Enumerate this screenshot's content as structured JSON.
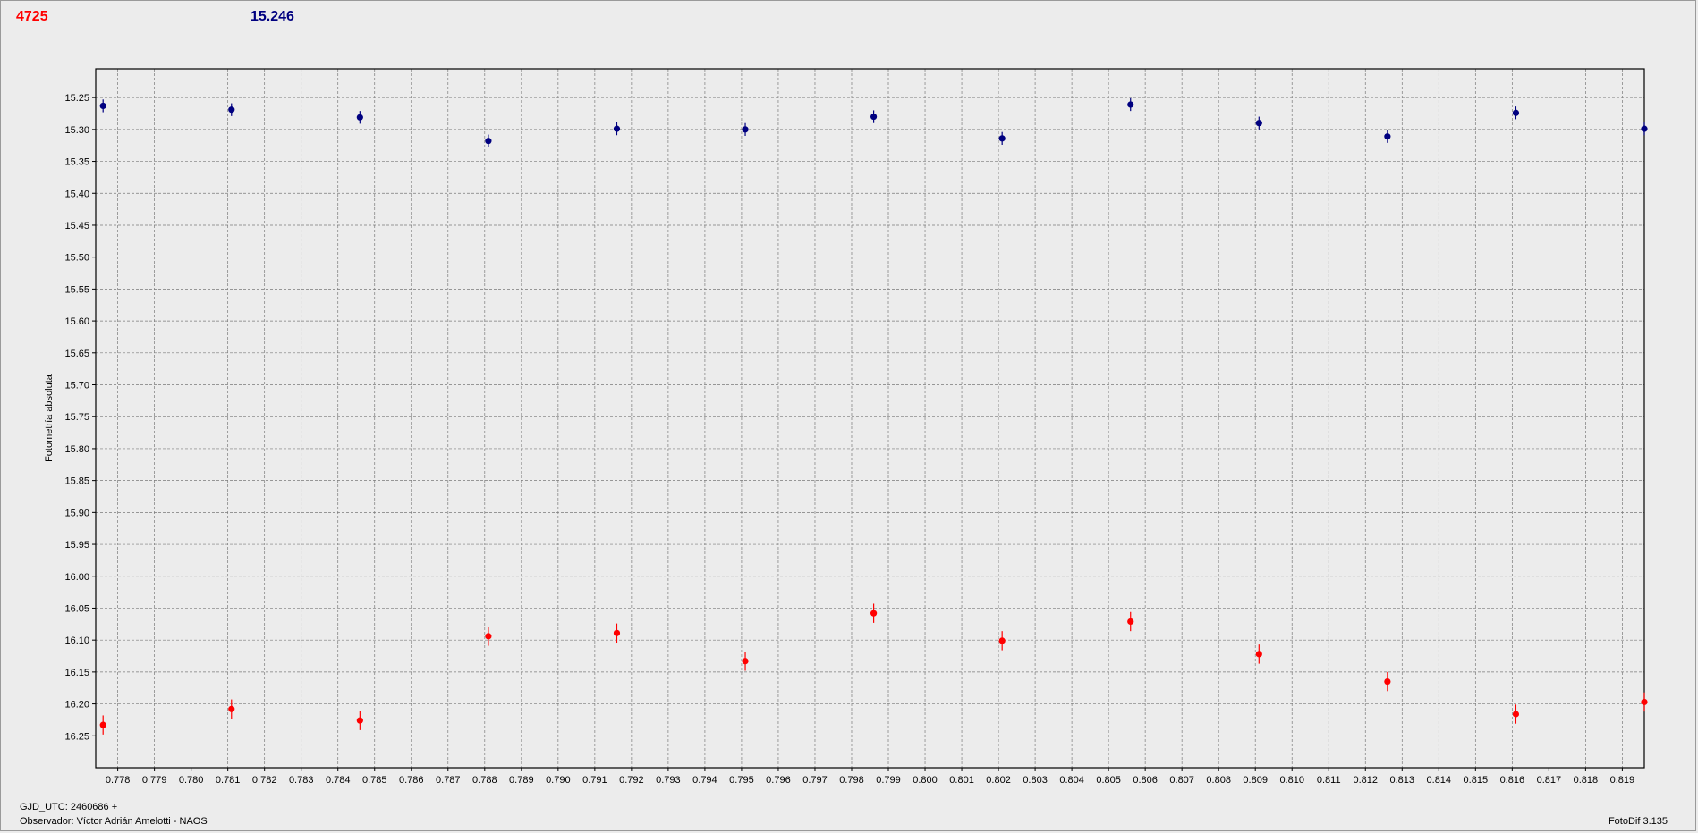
{
  "header": {
    "target_value": "4725",
    "comp_value": "15.246"
  },
  "footer": {
    "gjd": "GJD_UTC: 2460686 +",
    "observer": "Observador: Víctor Adrián Amelotti - NAOS",
    "version": "FotoDif 3.135"
  },
  "colors": {
    "target": "#ff0000",
    "comparison": "#000080",
    "background": "#ececec",
    "grid": "#7a7a7a"
  },
  "chart_data": {
    "type": "scatter",
    "title": "",
    "xlabel": "",
    "ylabel": "Fotometría absoluta",
    "xlim": [
      0.7774,
      0.8196
    ],
    "ylim": [
      16.3,
      15.205
    ],
    "y_inverted": true,
    "grid": true,
    "x_ticks": [
      0.778,
      0.779,
      0.78,
      0.781,
      0.782,
      0.783,
      0.784,
      0.785,
      0.786,
      0.787,
      0.788,
      0.789,
      0.79,
      0.791,
      0.792,
      0.793,
      0.794,
      0.795,
      0.796,
      0.797,
      0.798,
      0.799,
      0.8,
      0.801,
      0.802,
      0.803,
      0.804,
      0.805,
      0.806,
      0.807,
      0.808,
      0.809,
      0.81,
      0.811,
      0.812,
      0.813,
      0.814,
      0.815,
      0.816,
      0.817,
      0.818,
      0.819
    ],
    "y_ticks": [
      15.25,
      15.3,
      15.35,
      15.4,
      15.45,
      15.5,
      15.55,
      15.6,
      15.65,
      15.7,
      15.75,
      15.8,
      15.85,
      15.9,
      15.95,
      16.0,
      16.05,
      16.1,
      16.15,
      16.2,
      16.25
    ],
    "series": [
      {
        "marker_color": "#000080",
        "x": [
          0.7776,
          0.7811,
          0.7846,
          0.7881,
          0.7916,
          0.7951,
          0.7986,
          0.8021,
          0.8056,
          0.8091,
          0.8126,
          0.8161,
          0.8196
        ],
        "y": [
          15.263,
          15.269,
          15.281,
          15.318,
          15.299,
          15.3,
          15.28,
          15.314,
          15.261,
          15.29,
          15.311,
          15.274,
          15.299
        ],
        "err": [
          0.01,
          0.01,
          0.01,
          0.01,
          0.01,
          0.01,
          0.01,
          0.01,
          0.01,
          0.01,
          0.01,
          0.01,
          0.01
        ]
      },
      {
        "marker_color": "#ff0000",
        "x": [
          0.7776,
          0.7811,
          0.7846,
          0.7881,
          0.7916,
          0.7951,
          0.7986,
          0.8021,
          0.8056,
          0.8091,
          0.8126,
          0.8161,
          0.8196
        ],
        "y": [
          16.233,
          16.208,
          16.226,
          16.094,
          16.089,
          16.133,
          16.058,
          16.101,
          16.071,
          16.122,
          16.165,
          16.216,
          16.197
        ],
        "err": [
          0.015,
          0.015,
          0.015,
          0.015,
          0.015,
          0.015,
          0.015,
          0.015,
          0.015,
          0.015,
          0.015,
          0.015,
          0.015
        ]
      }
    ]
  }
}
